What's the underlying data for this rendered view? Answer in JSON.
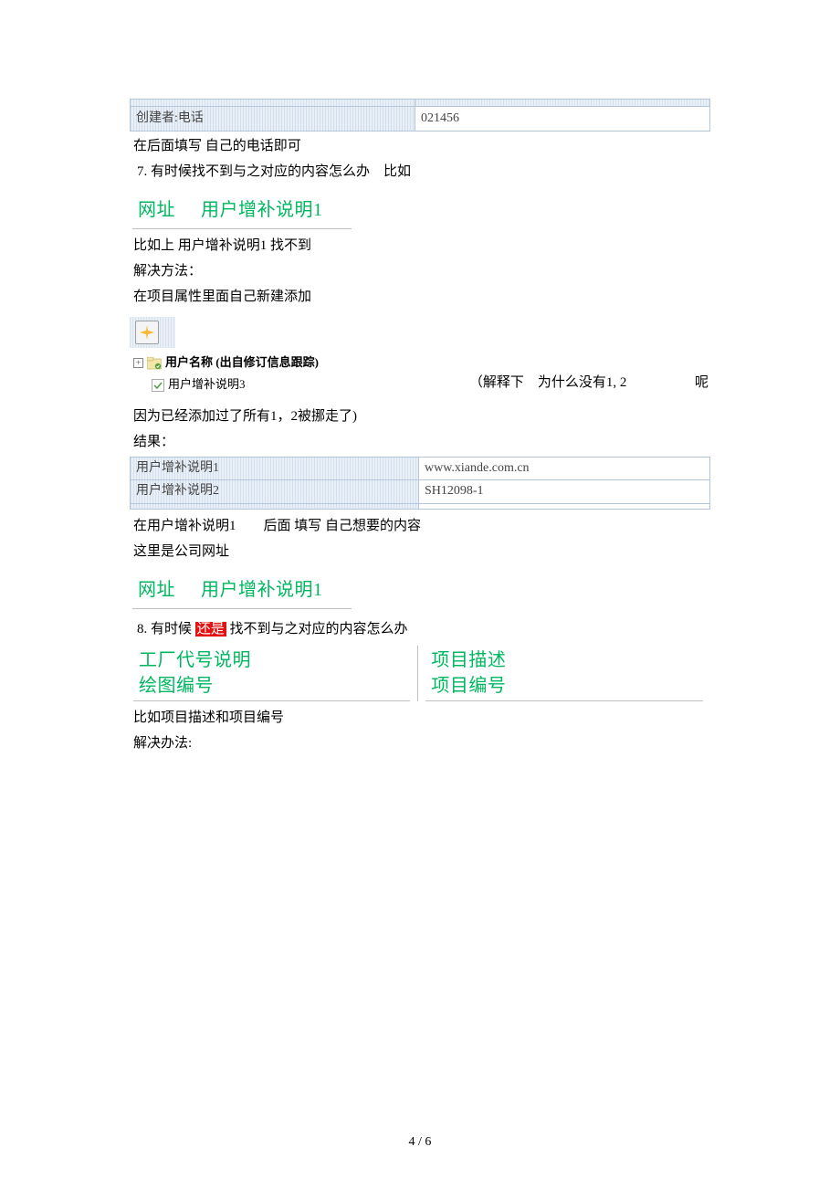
{
  "topTable": {
    "leftLabel": "创建者:电话",
    "rightValue": "021456"
  },
  "para1": "在后面填写 自己的电话即可",
  "line7": "7. 有时候找不到与之对应的内容怎么办　比如",
  "cyanBlock1": {
    "label": "网址",
    "value": "用户增补说明1"
  },
  "para2a": "比如上 用户增补说明1 找不到",
  "para2b": "解决方法：",
  "para2c": "在项目属性里面自己新建添加",
  "tree": {
    "nodeLabel": "用户名称 (出自修订信息跟踪)",
    "childLabel": "用户增补说明3",
    "explanation": "（解释下　为什么没有1, 2",
    "explanationTail": "呢"
  },
  "para3a": "因为已经添加过了所有1，2被挪走了)",
  "para3b": "结果：",
  "resultTable": {
    "row1Left": "用户增补说明1",
    "row1Right": "www.xiande.com.cn",
    "row2Left": "用户增补说明2",
    "row2Right": "SH12098-1"
  },
  "para4a": "在用户增补说明1　　后面 填写 自己想要的内容",
  "para4b": "这里是公司网址",
  "cyanBlock2": {
    "label": "网址",
    "value": "用户增补说明1"
  },
  "line8prefix": "8. 有时候 ",
  "line8highlight": "还是",
  "line8suffix": " 找不到与之对应的内容怎么办",
  "fourFields": {
    "topLeft": "工厂代号说明",
    "topRight": "项目描述",
    "botLeft": "绘图编号",
    "botRight": "项目编号"
  },
  "para5a": "比如项目描述和项目编号",
  "para5b": "解决办法:",
  "pageNumber": "4 / 6"
}
